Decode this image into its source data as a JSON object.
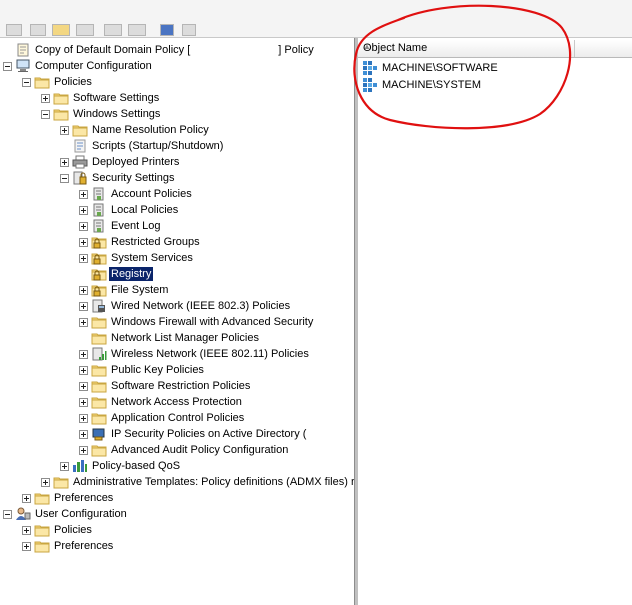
{
  "tree": [
    {
      "label": "Copy of Default Domain Policy [",
      "suffix": "] Policy",
      "icon": "policy-doc-icon",
      "toggle": "none",
      "depth": 0
    },
    {
      "label": "Computer Configuration",
      "icon": "computer-icon",
      "toggle": "minus",
      "depth": 0
    },
    {
      "label": "Policies",
      "icon": "folder-icon",
      "toggle": "minus",
      "depth": 1
    },
    {
      "label": "Software Settings",
      "icon": "folder-icon",
      "toggle": "plus",
      "depth": 2
    },
    {
      "label": "Windows Settings",
      "icon": "folder-icon",
      "toggle": "minus",
      "depth": 2
    },
    {
      "label": "Name Resolution Policy",
      "icon": "folder-icon",
      "toggle": "plus",
      "depth": 3
    },
    {
      "label": "Scripts (Startup/Shutdown)",
      "icon": "scripts-icon",
      "toggle": "none",
      "depth": 3
    },
    {
      "label": "Deployed Printers",
      "icon": "printer-icon",
      "toggle": "plus",
      "depth": 3
    },
    {
      "label": "Security Settings",
      "icon": "security-settings-icon",
      "toggle": "minus",
      "depth": 3
    },
    {
      "label": "Account Policies",
      "icon": "policy-book-icon",
      "toggle": "plus",
      "depth": 4
    },
    {
      "label": "Local Policies",
      "icon": "policy-book-icon",
      "toggle": "plus",
      "depth": 4
    },
    {
      "label": "Event Log",
      "icon": "policy-book-icon",
      "toggle": "plus",
      "depth": 4
    },
    {
      "label": "Restricted Groups",
      "icon": "lock-folder-icon",
      "toggle": "plus",
      "depth": 4
    },
    {
      "label": "System Services",
      "icon": "lock-folder-icon",
      "toggle": "plus",
      "depth": 4
    },
    {
      "label": "Registry",
      "icon": "lock-folder-icon",
      "toggle": "none",
      "depth": 4,
      "selected": true
    },
    {
      "label": "File System",
      "icon": "lock-folder-icon",
      "toggle": "plus",
      "depth": 4
    },
    {
      "label": "Wired Network (IEEE 802.3) Policies",
      "icon": "wired-network-icon",
      "toggle": "plus",
      "depth": 4
    },
    {
      "label": "Windows Firewall with Advanced Security",
      "icon": "folder-icon",
      "toggle": "plus",
      "depth": 4
    },
    {
      "label": "Network List Manager Policies",
      "icon": "folder-icon",
      "toggle": "none",
      "depth": 4
    },
    {
      "label": "Wireless Network (IEEE 802.11) Policies",
      "icon": "wireless-network-icon",
      "toggle": "plus",
      "depth": 4
    },
    {
      "label": "Public Key Policies",
      "icon": "folder-icon",
      "toggle": "plus",
      "depth": 4
    },
    {
      "label": "Software Restriction Policies",
      "icon": "folder-icon",
      "toggle": "plus",
      "depth": 4
    },
    {
      "label": "Network Access Protection",
      "icon": "folder-icon",
      "toggle": "plus",
      "depth": 4
    },
    {
      "label": "Application Control Policies",
      "icon": "folder-icon",
      "toggle": "plus",
      "depth": 4
    },
    {
      "label": "IP Security Policies on Active Directory (",
      "icon": "ip-security-icon",
      "toggle": "plus",
      "depth": 4
    },
    {
      "label": "Advanced Audit Policy Configuration",
      "icon": "folder-icon",
      "toggle": "plus",
      "depth": 4
    },
    {
      "label": "Policy-based QoS",
      "icon": "chart-bars-icon",
      "toggle": "plus",
      "depth": 3
    },
    {
      "label": "Administrative Templates: Policy definitions (ADMX files) re",
      "icon": "folder-icon",
      "toggle": "plus",
      "depth": 2
    },
    {
      "label": "Preferences",
      "icon": "folder-icon",
      "toggle": "plus",
      "depth": 1
    },
    {
      "label": "User Configuration",
      "icon": "user-icon",
      "toggle": "minus",
      "depth": 0
    },
    {
      "label": "Policies",
      "icon": "folder-icon",
      "toggle": "plus",
      "depth": 1
    },
    {
      "label": "Preferences",
      "icon": "folder-icon",
      "toggle": "plus",
      "depth": 1
    }
  ],
  "list": {
    "column_header": "Object Name",
    "items": [
      {
        "label": "MACHINE\\SOFTWARE",
        "icon": "registry-key-icon"
      },
      {
        "label": "MACHINE\\SYSTEM",
        "icon": "registry-key-icon"
      }
    ]
  },
  "colors": {
    "selection_bg": "#0a246a",
    "annotation_red": "#e01010",
    "folder": "#f6d77a"
  }
}
